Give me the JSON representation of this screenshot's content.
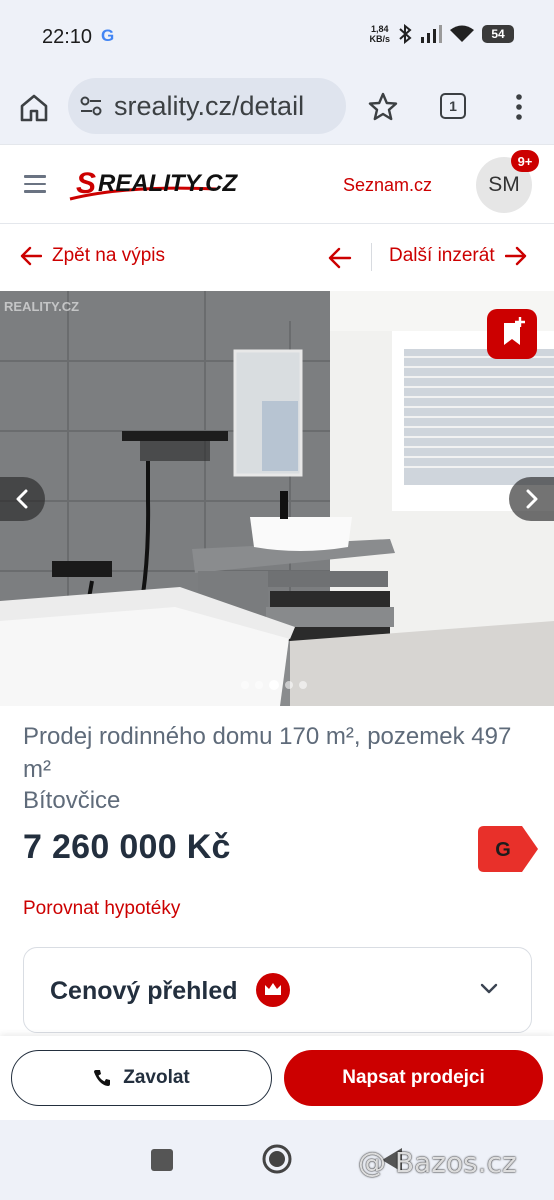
{
  "status_bar": {
    "time": "22:10",
    "google_icon": "G",
    "net_speed_value": "1,84",
    "net_speed_unit": "KB/s",
    "battery": "54",
    "icons": [
      "bluetooth-icon",
      "signal-icon",
      "wifi-icon",
      "battery-icon"
    ]
  },
  "browser": {
    "url": "sreality.cz/detail",
    "tab_count": "1",
    "icons": [
      "home-icon",
      "site-settings-icon",
      "bookmark-star-icon",
      "more-vert-icon"
    ]
  },
  "site_header": {
    "logo_text": "SREALITY.CZ",
    "seznam_link": "Seznam.cz",
    "avatar_initials": "SM",
    "notification_badge": "9+",
    "brand_color": "#cc0000"
  },
  "nav": {
    "back_label": "Zpět na výpis",
    "next_label": "Další inzerát"
  },
  "gallery": {
    "watermark": "REALITY.CZ",
    "dot_count": 5,
    "active_dot": 3
  },
  "listing": {
    "title": "Prodej rodinného domu 170 m², pozemek 497 m²",
    "locality": "Bítovčice",
    "price": "7 260 000 Kč",
    "energy_class": "G",
    "mortgage_link": "Porovnat hypotéky",
    "overview_title": "Cenový přehled"
  },
  "actions": {
    "call_label": "Zavolat",
    "write_label": "Napsat prodejci"
  },
  "watermark_text": "@ Bazos.cz"
}
